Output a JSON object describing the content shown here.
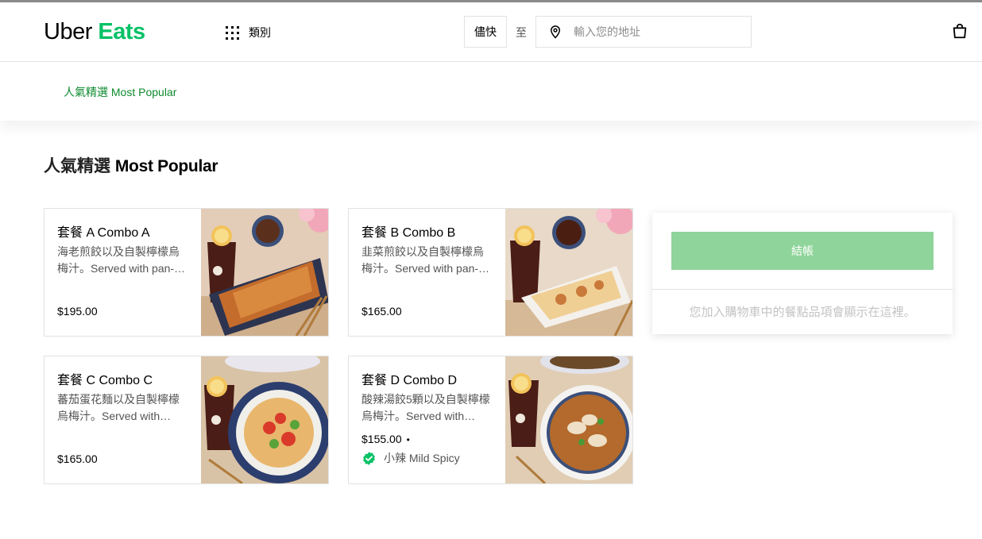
{
  "header": {
    "logo_uber": "Uber",
    "logo_eats": "Eats",
    "categories_label": "類別",
    "asap_label": "儘快",
    "to_label": "至",
    "address_placeholder": "輸入您的地址",
    "address_value": ""
  },
  "subnav": {
    "active_item": "人氣精選 Most Popular"
  },
  "section": {
    "title_zh": "人氣精選",
    "title_en": "Most Popular"
  },
  "items": [
    {
      "name": "套餐 A Combo A",
      "description": "海老煎餃以及自製檸檬烏梅汁。Served with pan-…",
      "price": "$195.00",
      "tag": ""
    },
    {
      "name": "套餐 B Combo B",
      "description": "韭菜煎餃以及自製檸檬烏梅汁。Served with pan-…",
      "price": "$165.00",
      "tag": ""
    },
    {
      "name": "套餐 C Combo C",
      "description": "蕃茄蛋花麵以及自製檸檬烏梅汁。Served with…",
      "price": "$165.00",
      "tag": ""
    },
    {
      "name": "套餐 D Combo D",
      "description": "酸辣湯餃5顆以及自製檸檬烏梅汁。Served with…",
      "price": "$155.00",
      "price_separator": "•",
      "tag": "小辣 Mild Spicy"
    }
  ],
  "cart": {
    "checkout_label": "結帳",
    "empty_message": "您加入購物車中的餐點品項會顯示在這裡。"
  },
  "icons": {
    "categories": "grid-icon",
    "address": "location-pin-icon",
    "cart": "shopping-bag-icon",
    "spicy_tag": "verified-badge-icon"
  },
  "colors": {
    "brand_green": "#06c167",
    "link_green": "#0e8a2e",
    "checkout_disabled": "#8fd49a",
    "badge_green": "#06c167"
  }
}
